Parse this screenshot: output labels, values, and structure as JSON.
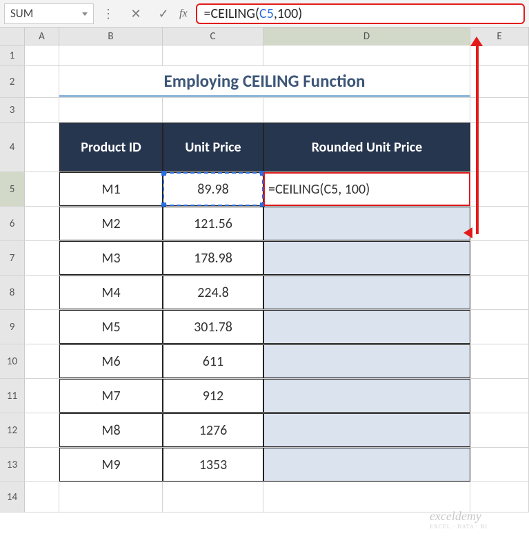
{
  "name_box": "SUM",
  "formula": {
    "eq": "=",
    "fn": "CEILING",
    "open": "(",
    "ref": "C5",
    "sep": ", ",
    "num": "100",
    "close": ")"
  },
  "columns": {
    "A": "A",
    "B": "B",
    "C": "C",
    "D": "D",
    "E": "E"
  },
  "row_nums": [
    "1",
    "2",
    "3",
    "4",
    "5",
    "6",
    "7",
    "8",
    "9",
    "10",
    "11",
    "12",
    "13",
    "14"
  ],
  "title": "Employing CEILING Function",
  "headers": {
    "b": "Product ID",
    "c": "Unit Price",
    "d": "Rounded Unit Price"
  },
  "d5_text": "=CEILING(C5, 100)",
  "table": [
    {
      "id": "M1",
      "price": "89.98"
    },
    {
      "id": "M2",
      "price": "121.56"
    },
    {
      "id": "M3",
      "price": "178.98"
    },
    {
      "id": "M4",
      "price": "224.8"
    },
    {
      "id": "M5",
      "price": "301.78"
    },
    {
      "id": "M6",
      "price": "611"
    },
    {
      "id": "M7",
      "price": "912"
    },
    {
      "id": "M8",
      "price": "1276"
    },
    {
      "id": "M9",
      "price": "1353"
    }
  ],
  "watermark": "exceldemy",
  "watermark_sub": "EXCEL · DATA · BI"
}
